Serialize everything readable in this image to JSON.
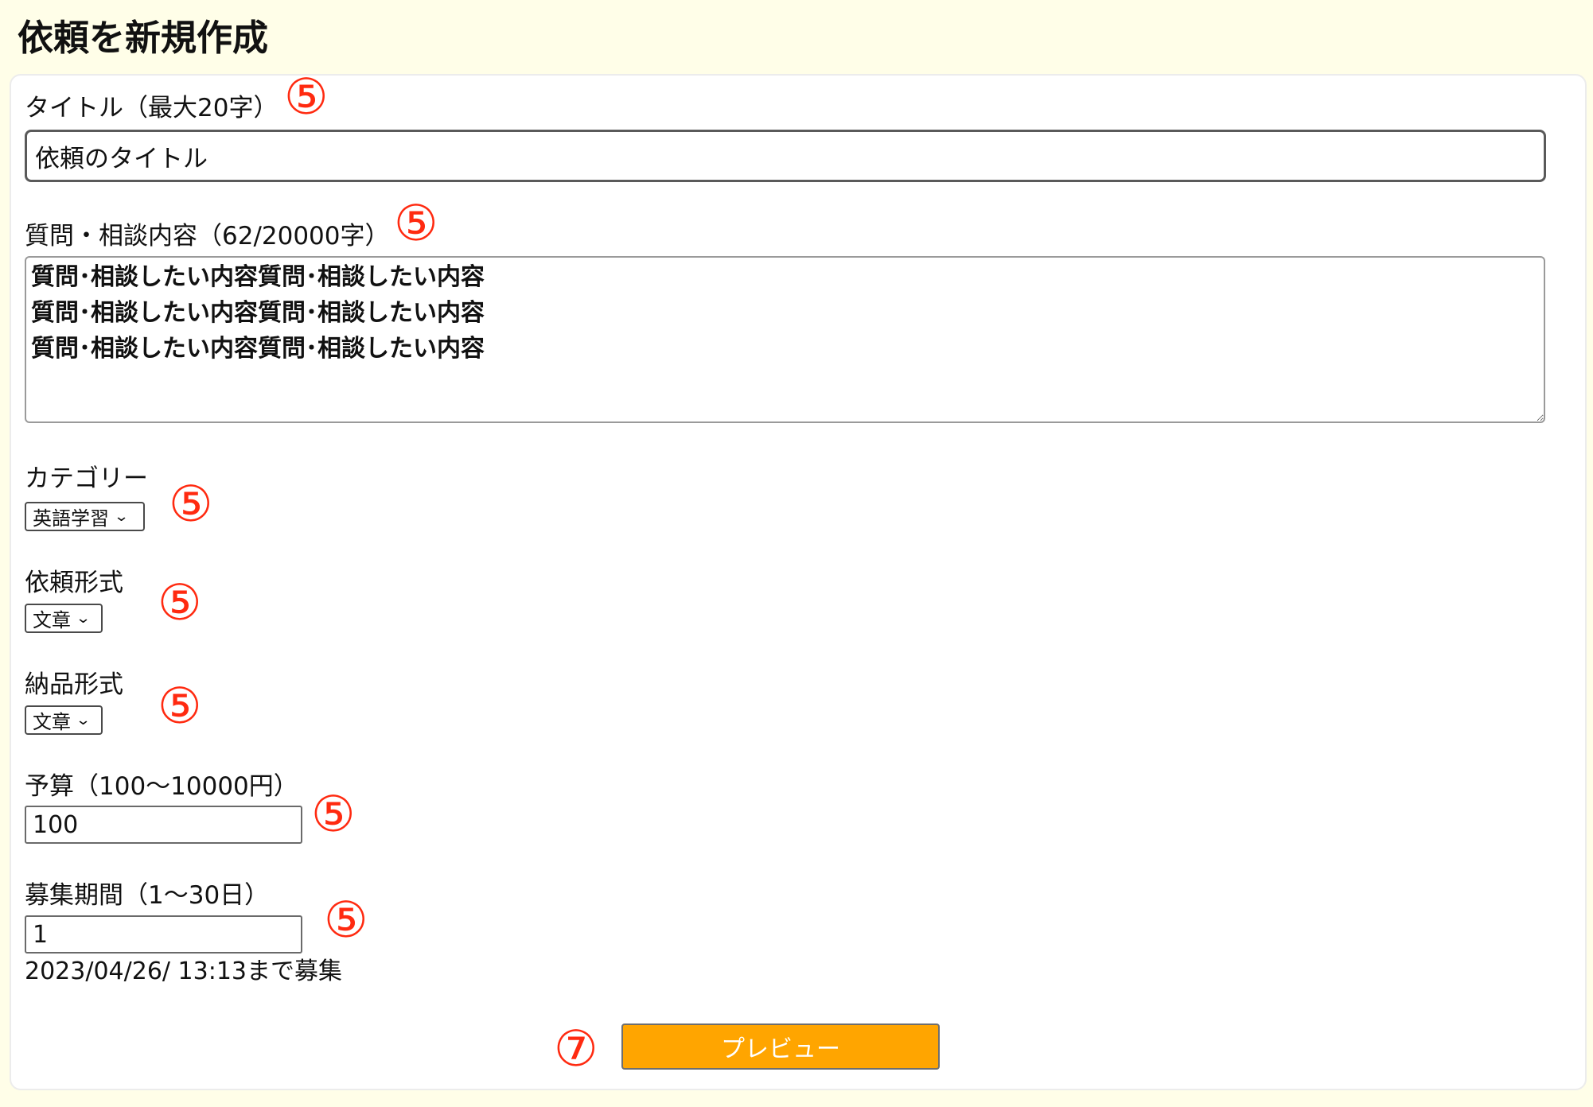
{
  "page": {
    "title": "依頼を新規作成"
  },
  "form": {
    "title_field": {
      "label": "タイトル（最大20字）",
      "value": "依頼のタイトル"
    },
    "content_field": {
      "label": "質問・相談内容（62/20000字）",
      "value": "質問･相談したい内容質問･相談したい内容\n質問･相談したい内容質問･相談したい内容\n質問･相談したい内容質問･相談したい内容"
    },
    "category_field": {
      "label": "カテゴリー",
      "selected": "英語学習"
    },
    "request_format_field": {
      "label": "依頼形式",
      "selected": "文章"
    },
    "delivery_format_field": {
      "label": "納品形式",
      "selected": "文章"
    },
    "budget_field": {
      "label": "予算（100〜10000円）",
      "value": "100"
    },
    "period_field": {
      "label": "募集期間（1〜30日）",
      "value": "1",
      "deadline_text": "2023/04/26/ 13:13まで募集"
    },
    "preview_button": {
      "label": "プレビュー"
    }
  },
  "annotations": {
    "mark_5": "⑤",
    "mark_7": "⑦",
    "color": "#ff2a10"
  },
  "icons": {
    "dropdown": "chevron-down-icon"
  },
  "colors": {
    "background": "#fffee8",
    "button": "#ffa500"
  }
}
